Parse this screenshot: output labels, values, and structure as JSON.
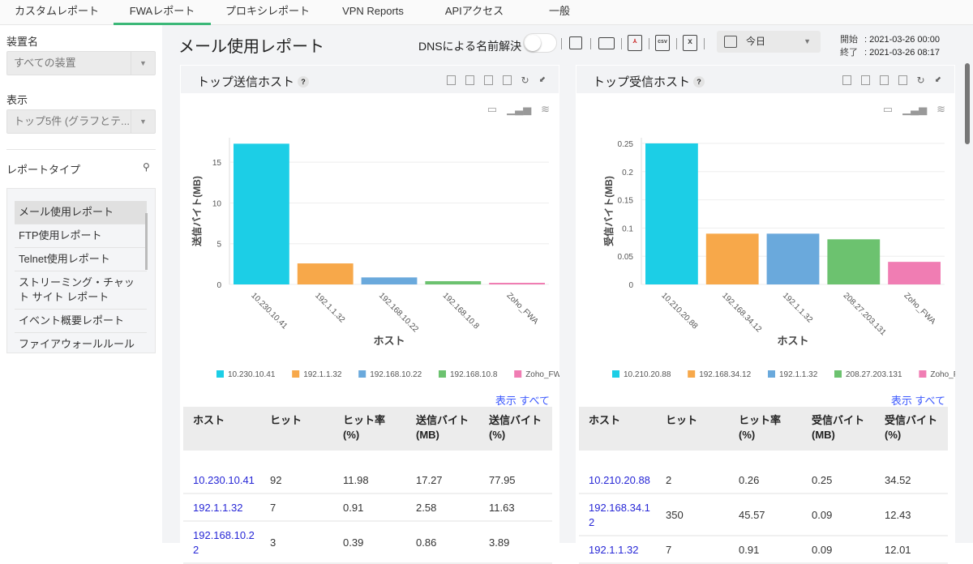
{
  "tabs": [
    "カスタムレポート",
    "FWAレポート",
    "プロキシレポート",
    "VPN Reports",
    "APIアクセス",
    "一般"
  ],
  "sidebar": {
    "device_label": "装置名",
    "device_value": "すべての装置",
    "view_label": "表示",
    "view_value": "トップ5件 (グラフとテ...",
    "report_type_label": "レポートタイプ",
    "report_types": [
      "メール使用レポート",
      "FTP使用レポート",
      "Telnet使用レポート",
      "ストリーミング・チャット サイト レポート",
      "イベント概要レポート",
      "ファイアウォールルールレ..."
    ]
  },
  "header": {
    "title": "メール使用レポート",
    "dns_label": "DNSによる名前解決",
    "csv": "csv",
    "xls": "x",
    "period": "今日",
    "start_label": "開始",
    "start_value": ": 2021-03-26 00:00",
    "end_label": "終了",
    "end_value": ": 2021-03-26 08:17"
  },
  "colors": [
    "#1ccee6",
    "#f7a84a",
    "#6aa9dc",
    "#6cc26f",
    "#f07db3"
  ],
  "chart_data": [
    {
      "type": "bar",
      "title": "トップ送信ホスト",
      "help": "?",
      "xlabel": "ホスト",
      "ylabel": "送信バイト(MB)",
      "categories": [
        "10.230.10.41",
        "192.1.1.32",
        "192.168.10.22",
        "192.168.10.8",
        "Zoho_FWA"
      ],
      "values": [
        17.27,
        2.58,
        0.86,
        0.4,
        0.2
      ],
      "ylim": [
        0,
        18
      ],
      "yticks": [
        0,
        5,
        10,
        15
      ],
      "grid": true,
      "legend": "bottom"
    },
    {
      "type": "bar",
      "title": "トップ受信ホスト",
      "help": "?",
      "xlabel": "ホスト",
      "ylabel": "受信バイト(MB)",
      "categories": [
        "10.210.20.88",
        "192.168.34.12",
        "192.1.1.32",
        "208.27.203.131",
        "Zoho_FWA"
      ],
      "values": [
        0.25,
        0.09,
        0.09,
        0.08,
        0.04
      ],
      "ylim": [
        0,
        0.26
      ],
      "yticks": [
        0,
        0.05,
        0.1,
        0.15,
        0.2,
        0.25
      ],
      "grid": true,
      "legend": "bottom"
    }
  ],
  "tables": [
    {
      "view_all": "表示 すべて",
      "headers": [
        "ホスト",
        "ヒット",
        "ヒット率(%)",
        "送信バイト (MB)",
        "送信バイト (%)"
      ],
      "rows": [
        [
          "10.230.10.41",
          "92",
          "11.98",
          "17.27",
          "77.95"
        ],
        [
          "192.1.1.32",
          "7",
          "0.91",
          "2.58",
          "11.63"
        ],
        [
          "192.168.10.22",
          "3",
          "0.39",
          "0.86",
          "3.89"
        ]
      ]
    },
    {
      "view_all": "表示 すべて",
      "headers": [
        "ホスト",
        "ヒット",
        "ヒット率(%)",
        "受信バイト (MB)",
        "受信バイト (%)"
      ],
      "rows": [
        [
          "10.210.20.88",
          "2",
          "0.26",
          "0.25",
          "34.52"
        ],
        [
          "192.168.34.12",
          "350",
          "45.57",
          "0.09",
          "12.43"
        ],
        [
          "192.1.1.32",
          "7",
          "0.91",
          "0.09",
          "12.01"
        ]
      ]
    }
  ]
}
